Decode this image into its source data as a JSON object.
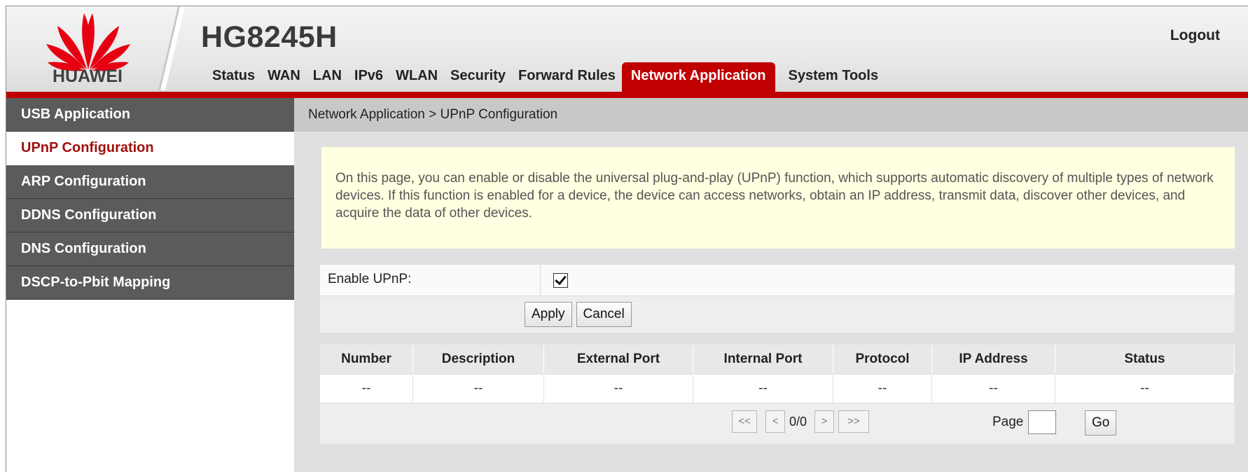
{
  "header": {
    "brand": "HUAWEI",
    "model": "HG8245H",
    "logout": "Logout",
    "nav": [
      {
        "label": "Status",
        "active": false
      },
      {
        "label": "WAN",
        "active": false
      },
      {
        "label": "LAN",
        "active": false
      },
      {
        "label": "IPv6",
        "active": false
      },
      {
        "label": "WLAN",
        "active": false
      },
      {
        "label": "Security",
        "active": false
      },
      {
        "label": "Forward Rules",
        "active": false
      },
      {
        "label": "Network Application",
        "active": true
      },
      {
        "label": "System Tools",
        "active": false
      }
    ]
  },
  "sidebar": {
    "items": [
      {
        "label": "USB Application",
        "active": false
      },
      {
        "label": "UPnP Configuration",
        "active": true
      },
      {
        "label": "ARP Configuration",
        "active": false
      },
      {
        "label": "DDNS Configuration",
        "active": false
      },
      {
        "label": "DNS Configuration",
        "active": false
      },
      {
        "label": "DSCP-to-Pbit Mapping",
        "active": false
      }
    ]
  },
  "main": {
    "breadcrumb": "Network Application > UPnP Configuration",
    "info": "On this page, you can enable or disable the universal plug-and-play (UPnP) function, which supports automatic discovery of multiple types of network devices. If this function is enabled for a device, the device can access networks, obtain an IP address, transmit data, discover other devices, and acquire the data of other devices.",
    "enable_label": "Enable UPnP:",
    "enable_checked": true,
    "apply": "Apply",
    "cancel": "Cancel",
    "table": {
      "headers": [
        "Number",
        "Description",
        "External Port",
        "Internal Port",
        "Protocol",
        "IP Address",
        "Status"
      ],
      "rows": [
        [
          "--",
          "--",
          "--",
          "--",
          "--",
          "--",
          "--"
        ]
      ]
    },
    "pager": {
      "first": "<<",
      "prev": "<",
      "info": "0/0",
      "next": ">",
      "last": ">>",
      "page_label": "Page",
      "page_value": "",
      "go": "Go"
    }
  },
  "colors": {
    "accent": "#c00000",
    "sidebar": "#5b5b5b",
    "info_bg": "#ffffe1"
  }
}
